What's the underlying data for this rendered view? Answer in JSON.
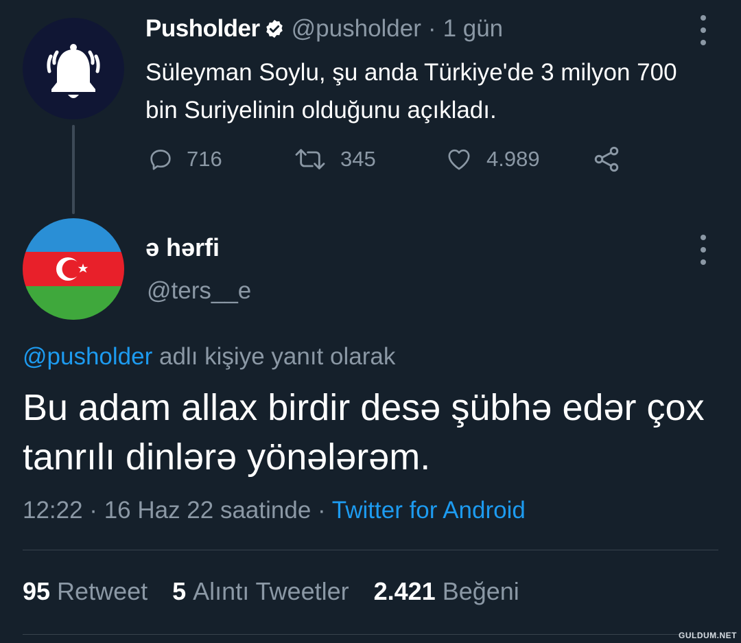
{
  "parent_tweet": {
    "author_name": "Pusholder",
    "handle": "@pusholder",
    "separator": "·",
    "time": "1 gün",
    "text": "Süleyman Soylu, şu anda Türkiye'de 3 milyon 700 bin Suriyelinin olduğunu açıkladı.",
    "reply_count": "716",
    "retweet_count": "345",
    "like_count": "4.989",
    "avatar_icon": "bell-icon",
    "verified_icon": "verified-badge-icon"
  },
  "reply_tweet": {
    "author_name": "ə hərfi",
    "handle": "@ters__e",
    "avatar_icon": "azerbaijan-flag",
    "replying_to_handle": "@pusholder",
    "replying_to_suffix": " adlı kişiye yanıt olarak",
    "text": "Bu adam allax birdir desə şübhə edər çox tanrılı dinlərə yönələrəm.",
    "time": "12:22 · 16 Haz 22 saatinde",
    "meta_separator": " · ",
    "source": "Twitter for Android",
    "stats": [
      {
        "count": "95",
        "label": "Retweet"
      },
      {
        "count": "5",
        "label": "Alıntı Tweetler"
      },
      {
        "count": "2.421",
        "label": "Beğeni"
      }
    ]
  },
  "watermark": "GULDUM.NET",
  "colors": {
    "background": "#15202b",
    "muted_text": "#8b98a5",
    "link": "#1d9bf0",
    "verified": "#ffffff",
    "flag_blue": "#2a8fd6",
    "flag_red": "#e8202a",
    "flag_green": "#3fa83c"
  }
}
